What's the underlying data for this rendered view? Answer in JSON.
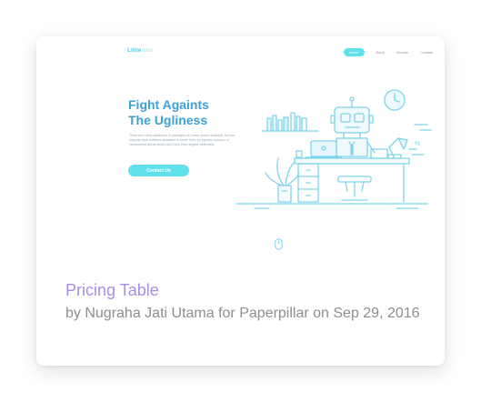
{
  "shot": {
    "brand": {
      "name": "Little",
      "suffix": "robo"
    },
    "nav": [
      {
        "label": "Home",
        "active": true
      },
      {
        "label": "Work",
        "active": false
      },
      {
        "label": "Service",
        "active": false
      },
      {
        "label": "Contact",
        "active": false
      }
    ],
    "hero": {
      "headline_line1": "Fight Againts",
      "headline_line2": "The Ugliness",
      "paragraph": "There are many variations of passages of Lorem Ipsum available, but the majority have suffered alteration in some form, by injected humour, or randomised words which don't look even slightly believable.",
      "cta_label": "Contact Us"
    },
    "illustration": {
      "text_mark": "%",
      "icons": [
        "robot-icon",
        "clock-icon",
        "laptop-icon",
        "desk-lamp-icon",
        "plant-icon",
        "books-icon",
        "chair-icon"
      ]
    },
    "scroll_icon": "mouse-scroll-icon"
  },
  "caption": {
    "title": "Pricing Table",
    "byline": "by Nugraha Jati Utama for Paperpillar on Sep 29, 2016"
  },
  "colors": {
    "accent": "#5fe0ea",
    "line": "#7fd3ec",
    "headline": "#3fa0d6",
    "caption_title": "#a98ee6",
    "caption_byline": "#8e8e8e"
  }
}
